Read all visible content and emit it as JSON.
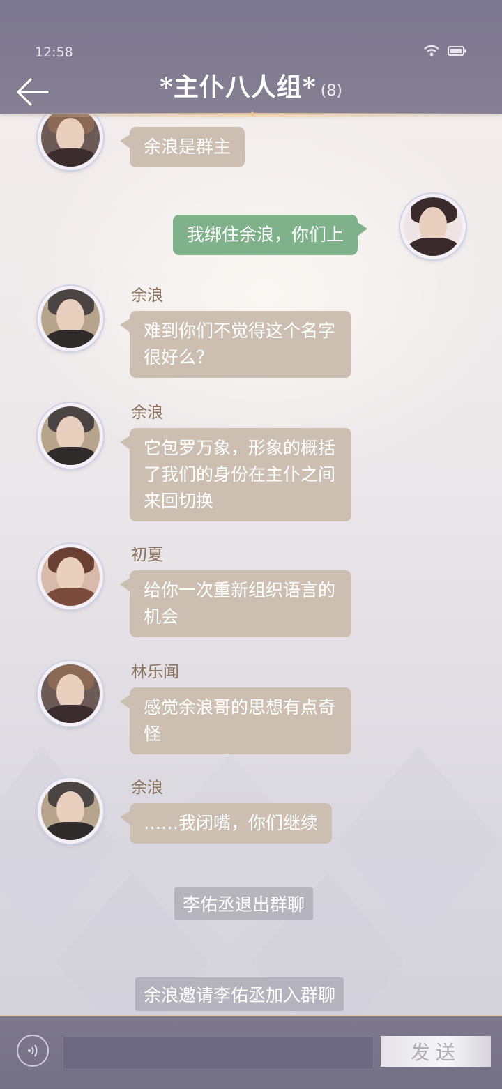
{
  "status": {
    "time": "12:58"
  },
  "header": {
    "title": "*主仆八人组*",
    "count": "(8)"
  },
  "messages": [
    {
      "sender": "",
      "text": "余浪是群主"
    },
    {
      "sender": "",
      "text": "我绑住余浪，你们上",
      "self": true
    },
    {
      "sender": "余浪",
      "text": "难到你们不觉得这个名字很好么？"
    },
    {
      "sender": "余浪",
      "text": "它包罗万象，形象的概括了我们的身份在主仆之间来回切换"
    },
    {
      "sender": "初夏",
      "text": "给你一次重新组织语言的机会"
    },
    {
      "sender": "林乐闻",
      "text": "感觉余浪哥的思想有点奇怪"
    },
    {
      "sender": "余浪",
      "text": "……我闭嘴，你们继续"
    }
  ],
  "system_messages": [
    "李佑丞退出群聊",
    "余浪邀请李佑丞加入群聊"
  ],
  "input": {
    "placeholder": "",
    "send_label": "发送"
  },
  "colors": {
    "header": "#7c7890",
    "bubble": "#ccbfb2",
    "self_bubble": "#7fb28a",
    "name": "#8a735d"
  },
  "icons": {
    "back": "arrow-left-icon",
    "voice": "voice-icon",
    "wifi": "wifi-icon",
    "battery": "battery-icon"
  }
}
